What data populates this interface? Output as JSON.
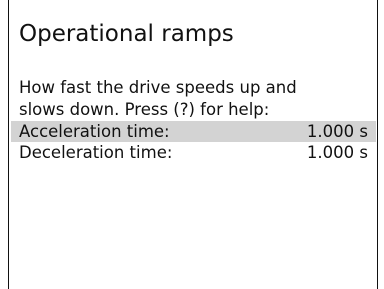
{
  "screen": {
    "title": "Operational ramps",
    "description_lines": [
      "How fast the drive speeds up and",
      "slows down. Press (?) for help:"
    ],
    "parameters": [
      {
        "label": "Acceleration time:",
        "value": "1.000 s",
        "selected": true
      },
      {
        "label": "Deceleration time:",
        "value": "1.000 s",
        "selected": false
      }
    ]
  },
  "colors": {
    "selection_background": "#d3d3d3",
    "text": "#111111",
    "border": "#111111",
    "background": "#ffffff"
  }
}
